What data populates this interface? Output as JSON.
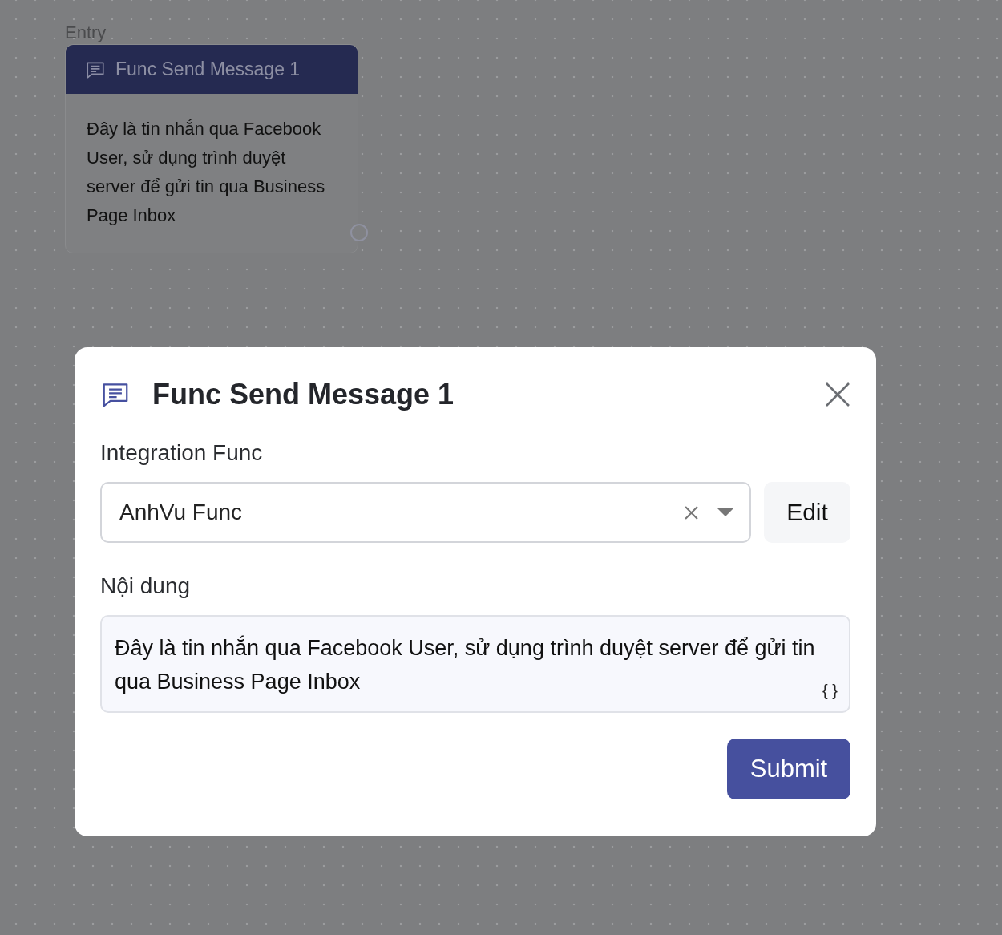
{
  "canvas": {
    "node": {
      "label": "Entry",
      "title": "Func Send Message 1",
      "body": "Đây là tin nhắn qua Facebook User, sử dụng trình duyệt server để gửi tin qua Business Page Inbox"
    }
  },
  "dialog": {
    "title": "Func Send Message 1",
    "fields": [
      {
        "kind": "select",
        "label": "Integration Func",
        "value": "AnhVu Func",
        "button": "Edit"
      },
      {
        "kind": "textarea",
        "label": "Nội dung",
        "value": "Đây là tin nhắn qua Facebook User, sử dụng trình duyệt server để gửi tin qua Business Page Inbox",
        "hint": "{ }"
      }
    ],
    "submit": "Submit"
  }
}
